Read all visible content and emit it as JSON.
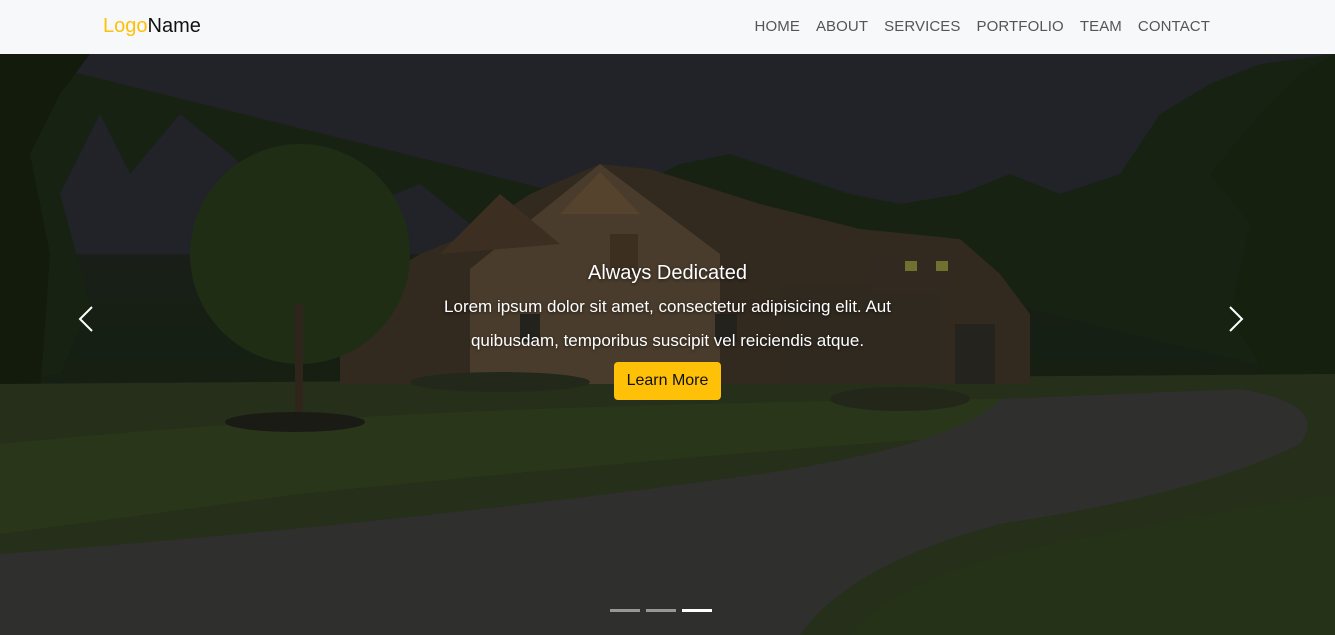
{
  "brand": {
    "logo": "Logo",
    "name": "Name"
  },
  "nav": {
    "items": [
      {
        "label": "HOME"
      },
      {
        "label": "ABOUT"
      },
      {
        "label": "SERVICES"
      },
      {
        "label": "PORTFOLIO"
      },
      {
        "label": "TEAM"
      },
      {
        "label": "CONTACT"
      }
    ]
  },
  "hero": {
    "heading": "Always Dedicated",
    "text": "Lorem ipsum dolor sit amet, consectetur adipisicing elit. Aut quibusdam, temporibus suscipit vel reiciendis atque.",
    "button": "Learn More",
    "slides_count": 3,
    "active_slide": 3
  },
  "icons": {
    "prev": "chevron-left-icon",
    "next": "chevron-right-icon"
  },
  "colors": {
    "accent": "#ffc107",
    "navbar_bg": "#f7f8fa",
    "nav_text": "#555555"
  }
}
